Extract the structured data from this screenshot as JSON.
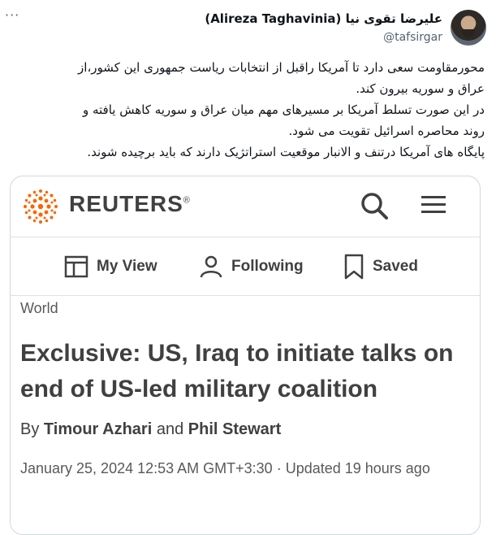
{
  "tweet": {
    "author_name": "علیرضا تقوی نیا (Alireza Taghavinia)",
    "handle": "@tafsirgar",
    "more_label": "···",
    "lines": [
      "محورمقاومت سعی دارد تا آمریکا راقبل از انتخابات ریاست جمهوری این کشور،از",
      "عراق و سوریه بیرون کند.",
      "در این صورت تسلط آمریکا بر مسیرهای مهم میان عراق و سوریه کاهش یافته و",
      "روند محاصره اسرائیل تقویت می شود.",
      "پایگاه های آمریکا درتنف و الانبار موقعیت استراتژیک دارند که باید برچیده شوند."
    ]
  },
  "card": {
    "brand": "REUTERS",
    "brand_mark": "®",
    "brand_color": "#fa6400",
    "actions": {
      "my_view": "My View",
      "following": "Following",
      "saved": "Saved"
    },
    "section": "World",
    "headline": "Exclusive: US, Iraq to initiate talks on end of US-led military coalition",
    "byline": {
      "prefix": "By",
      "author1": "Timour Azhari",
      "joiner": "and",
      "author2": "Phil Stewart"
    },
    "date": "January 25, 2024 12:53 AM GMT+3:30 · Updated 19 hours ago"
  }
}
